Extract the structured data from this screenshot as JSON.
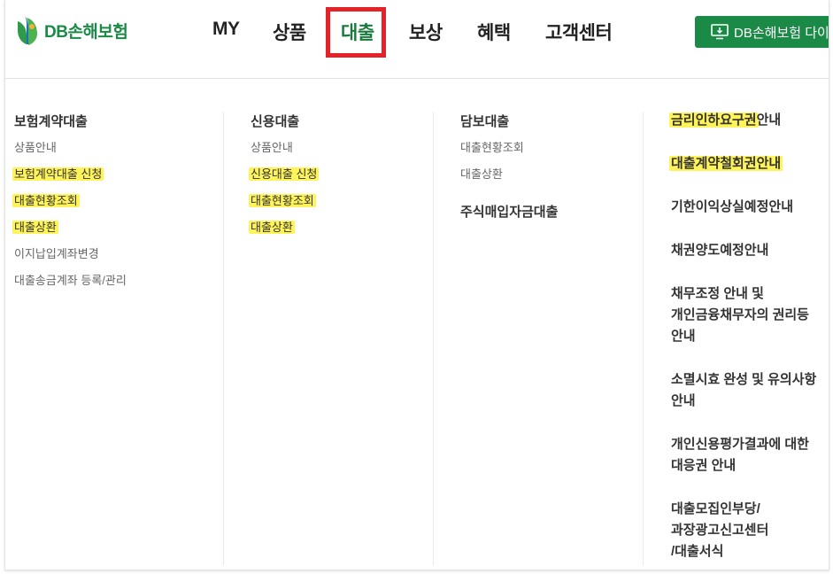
{
  "header": {
    "logo_text": "DB손해보험",
    "nav": [
      "MY",
      "상품",
      "대출",
      "보상",
      "혜택",
      "고객센터"
    ],
    "active_nav": "대출",
    "cta_label": "DB손해보험 다이렉트"
  },
  "menu": {
    "col1": {
      "title": "보험계약대출",
      "links": [
        "상품안내",
        "보험계약대출 신청",
        "대출현황조회",
        "대출상환",
        "이지납입계좌변경",
        "대출송금계좌 등록/관리"
      ]
    },
    "col2": {
      "title": "신용대출",
      "links": [
        "상품안내",
        "신용대출 신청",
        "대출현황조회",
        "대출상환"
      ]
    },
    "col3": {
      "title": "담보대출",
      "links": [
        "대출현황조회",
        "대출상환"
      ],
      "sub_title": "주식매입자금대출"
    },
    "col4": {
      "item1_hl": "금리인하요구권",
      "item1_rest": "안내",
      "item2": "대출계약철회권안내",
      "item3": "기한이익상실예정안내",
      "item4": "채권양도예정안내",
      "item5_l1": "채무조정 안내 및",
      "item5_l2": "개인금융채무자의 권리등",
      "item5_l3": "안내",
      "item6_l1": "소멸시효 완성 및 유의사항",
      "item6_l2": "안내",
      "item7_l1": "개인신용평가결과에 대한",
      "item7_l2": "대응권 안내",
      "item8_l1": "대출모집인부당/",
      "item8_l2": "과장광고신고센터",
      "item8_l3": "/대출서식"
    }
  },
  "colors": {
    "brand": "#1a8a46",
    "highlight": "#fff35a",
    "box": "#e52228"
  }
}
